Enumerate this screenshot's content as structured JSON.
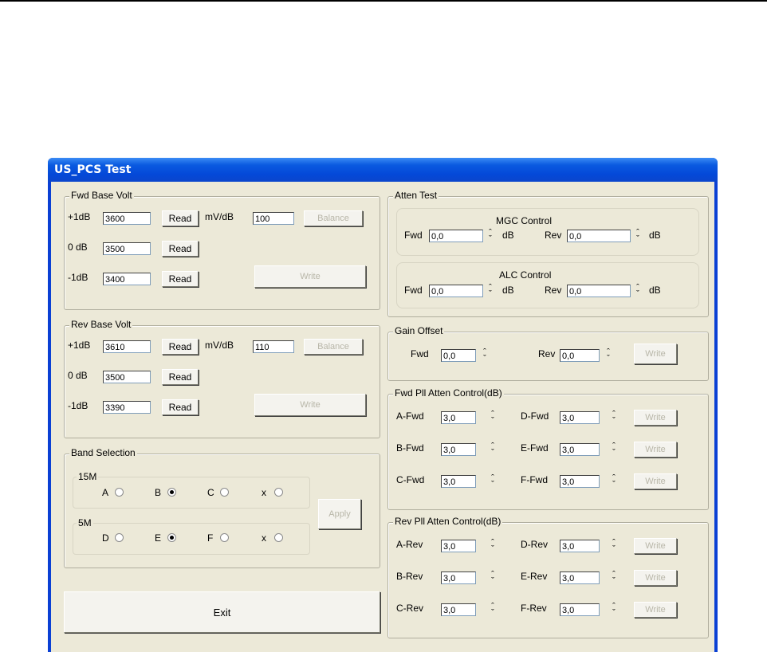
{
  "window": {
    "title": "US_PCS Test"
  },
  "fwd_base": {
    "group": "Fwd Base Volt",
    "p1_label": "+1dB",
    "p1_value": "3600",
    "z_label": "0 dB",
    "z_value": "3500",
    "m1_label": "-1dB",
    "m1_value": "3400",
    "read": "Read",
    "mvdb_label": "mV/dB",
    "mvdb_value": "100",
    "balance": "Balance",
    "write": "Write"
  },
  "rev_base": {
    "group": "Rev Base Volt",
    "p1_label": "+1dB",
    "p1_value": "3610",
    "z_label": "0 dB",
    "z_value": "3500",
    "m1_label": "-1dB",
    "m1_value": "3390",
    "read": "Read",
    "mvdb_label": "mV/dB",
    "mvdb_value": "110",
    "balance": "Balance",
    "write": "Write"
  },
  "band": {
    "group": "Band Selection",
    "m15": {
      "label": "15M",
      "options": [
        "A",
        "B",
        "C",
        "x"
      ],
      "selected": "B"
    },
    "m5": {
      "label": "5M",
      "options": [
        "D",
        "E",
        "F",
        "x"
      ],
      "selected": "E"
    },
    "apply": "Apply"
  },
  "exit": "Exit",
  "atten": {
    "group": "Atten Test",
    "mgc": {
      "title": "MGC Control",
      "fwd_label": "Fwd",
      "fwd_value": "0,0",
      "rev_label": "Rev",
      "rev_value": "0,0",
      "unit": "dB"
    },
    "alc": {
      "title": "ALC Control",
      "fwd_label": "Fwd",
      "fwd_value": "0,0",
      "rev_label": "Rev",
      "rev_value": "0,0",
      "unit": "dB"
    }
  },
  "gain_offset": {
    "group": "Gain Offset",
    "fwd_label": "Fwd",
    "fwd_value": "0,0",
    "rev_label": "Rev",
    "rev_value": "0,0",
    "write": "Write"
  },
  "fwd_pll": {
    "group": "Fwd Pll Atten Control(dB)",
    "rows": [
      {
        "l1": "A-Fwd",
        "v1": "3,0",
        "l2": "D-Fwd",
        "v2": "3,0",
        "write": "Write"
      },
      {
        "l1": "B-Fwd",
        "v1": "3,0",
        "l2": "E-Fwd",
        "v2": "3,0",
        "write": "Write"
      },
      {
        "l1": "C-Fwd",
        "v1": "3,0",
        "l2": "F-Fwd",
        "v2": "3,0",
        "write": "Write"
      }
    ]
  },
  "rev_pll": {
    "group": "Rev Pll Atten Control(dB)",
    "rows": [
      {
        "l1": "A-Rev",
        "v1": "3,0",
        "l2": "D-Rev",
        "v2": "3,0",
        "write": "Write"
      },
      {
        "l1": "B-Rev",
        "v1": "3,0",
        "l2": "E-Rev",
        "v2": "3,0",
        "write": "Write"
      },
      {
        "l1": "C-Rev",
        "v1": "3,0",
        "l2": "F-Rev",
        "v2": "3,0",
        "write": "Write"
      }
    ]
  }
}
